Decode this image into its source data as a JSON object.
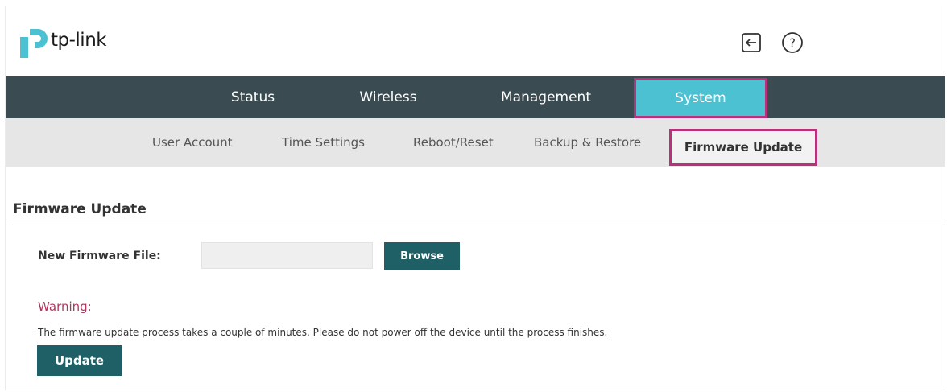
{
  "header": {
    "brand": "tp-link",
    "icons": [
      "logout-icon",
      "help-icon"
    ]
  },
  "main_nav": {
    "tabs": [
      {
        "label": "Status",
        "selected": false
      },
      {
        "label": "Wireless",
        "selected": false
      },
      {
        "label": "Management",
        "selected": false
      },
      {
        "label": "System",
        "selected": true
      }
    ]
  },
  "sub_nav": {
    "items": [
      {
        "label": "User Account",
        "selected": false
      },
      {
        "label": "Time Settings",
        "selected": false
      },
      {
        "label": "Reboot/Reset",
        "selected": false
      },
      {
        "label": "Backup & Restore",
        "selected": false
      },
      {
        "label": "Firmware Update",
        "selected": true
      }
    ]
  },
  "content": {
    "section_title": "Firmware Update",
    "file_label": "New Firmware File:",
    "file_value": "",
    "browse_label": "Browse",
    "warning_label": "Warning:",
    "warning_text": "The firmware update process takes a couple of minutes. Please do not power off the device until the process finishes.",
    "update_label": "Update"
  },
  "colors": {
    "nav_bg": "#3a4b51",
    "active_tab": "#4bc1d2",
    "highlight_border": "#b8317a",
    "button_bg": "#1f5f66",
    "warning": "#b0365e",
    "brand_cyan": "#4bc1d2"
  }
}
